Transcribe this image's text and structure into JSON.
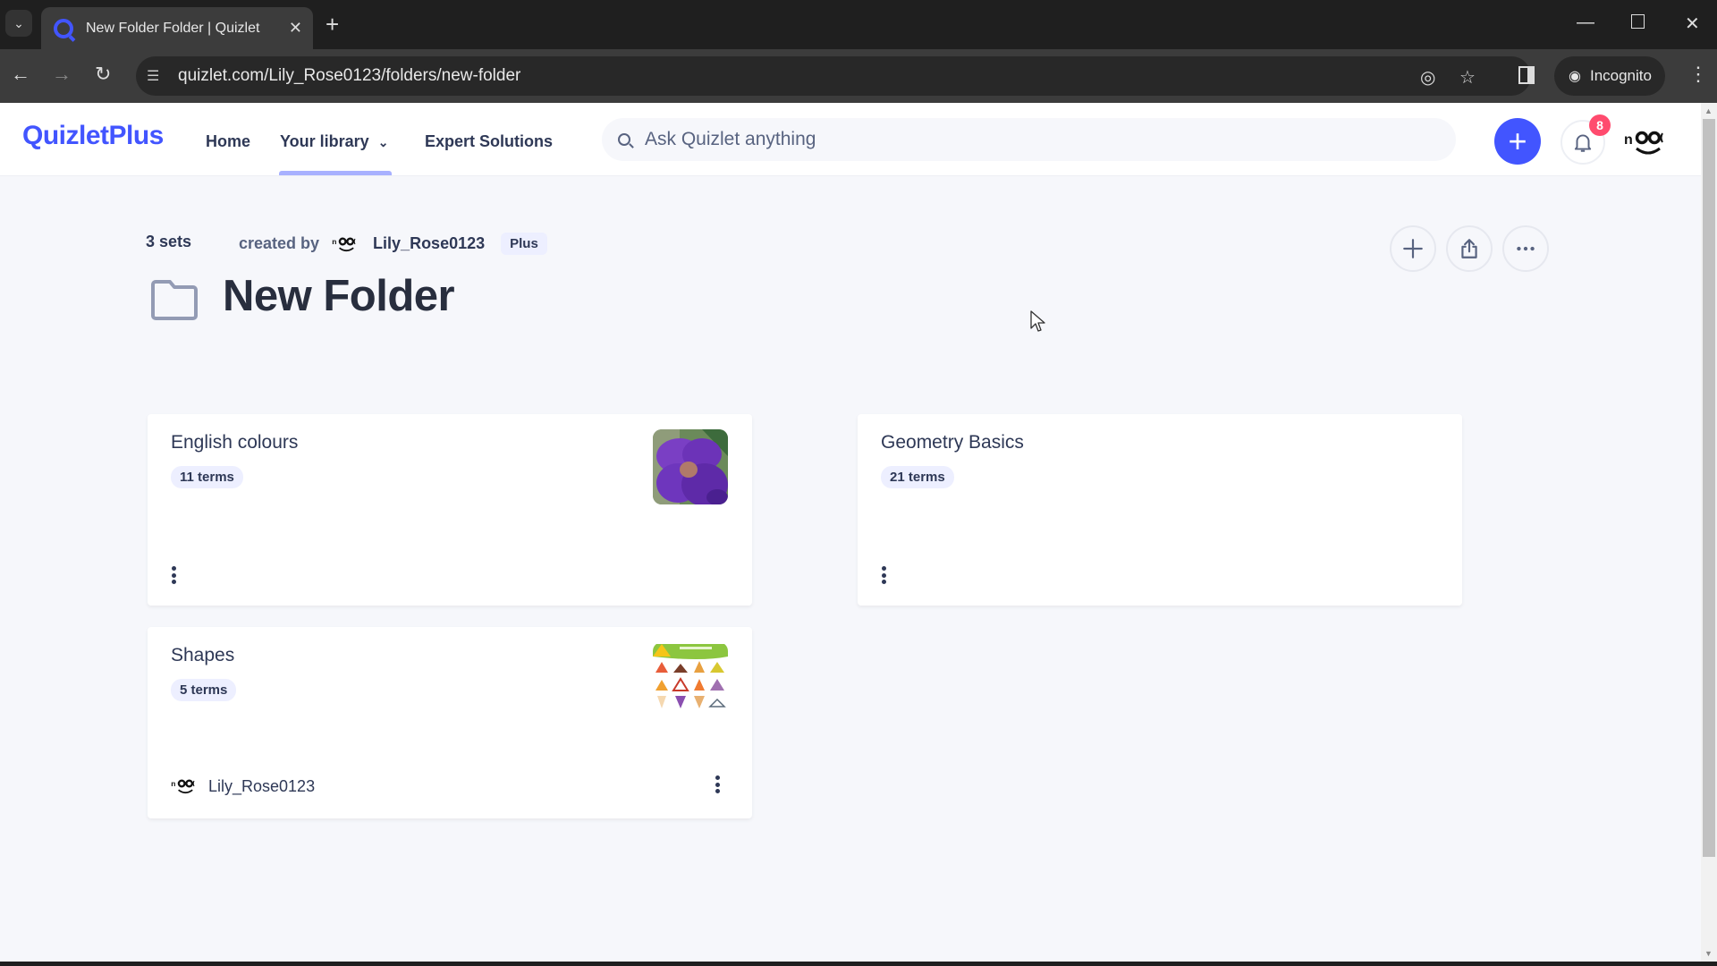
{
  "browser": {
    "tab_title": "New Folder Folder | Quizlet",
    "url": "quizlet.com/Lily_Rose0123/folders/new-folder",
    "incognito_label": "Incognito",
    "icons": [
      "tab-search-icon",
      "favicon-quizlet",
      "close-tab-icon",
      "new-tab-icon",
      "minimize-icon",
      "maximize-icon",
      "close-window-icon",
      "back-icon",
      "forward-icon",
      "reload-icon",
      "site-settings-icon",
      "eye-off-icon",
      "star-icon",
      "side-panel-icon",
      "incognito-icon",
      "kebab-menu-icon"
    ]
  },
  "header": {
    "logo": "QuizletPlus",
    "nav": [
      {
        "label": "Home"
      },
      {
        "label": "Your library",
        "active": true
      },
      {
        "label": "Expert Solutions"
      }
    ],
    "search_placeholder": "Ask Quizlet anything",
    "notification_count": "8",
    "accent": "#4255ff"
  },
  "folder": {
    "sets_count": "3 sets",
    "created_by_label": "created by",
    "creator": "Lily_Rose0123",
    "plan_tag": "Plus",
    "title": "New Folder"
  },
  "sets": [
    {
      "title": "English colours",
      "terms": "11 terms",
      "thumbnail": "purple-orchid",
      "owner": null
    },
    {
      "title": "Geometry Basics",
      "terms": "21 terms",
      "thumbnail": null,
      "owner": null
    },
    {
      "title": "Shapes",
      "terms": "5 terms",
      "thumbnail": "triangle-shapes-chart",
      "owner": "Lily_Rose0123"
    }
  ]
}
